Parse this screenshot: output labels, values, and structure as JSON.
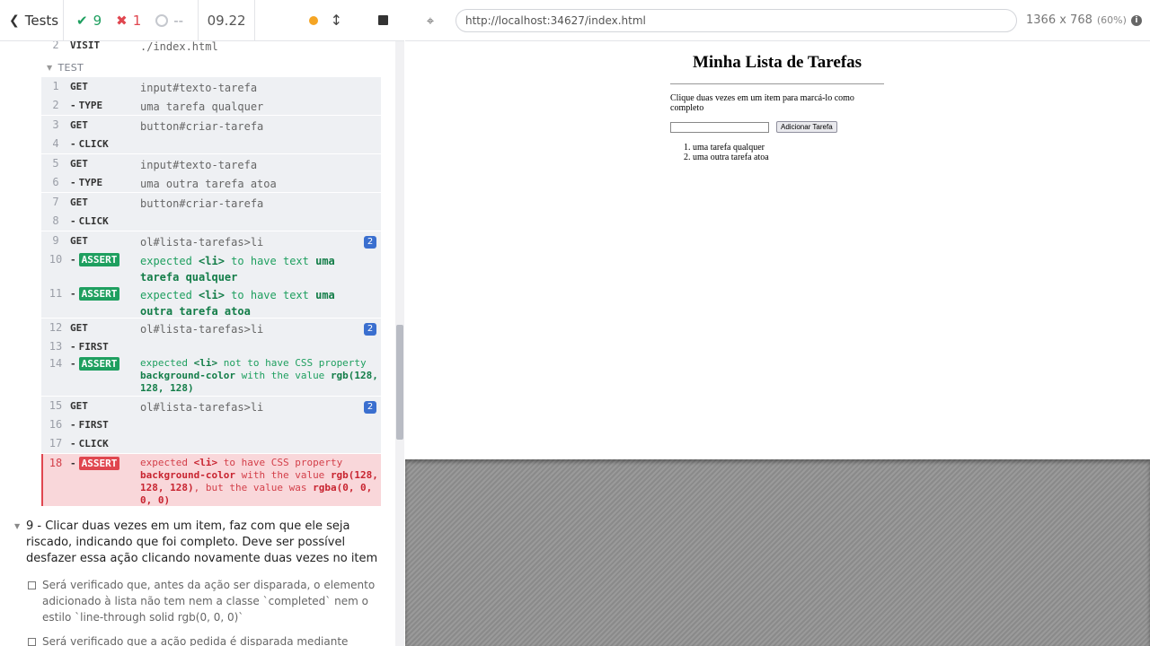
{
  "topbar": {
    "tests_label": "Tests",
    "passed": "9",
    "failed": "1",
    "pending": "--",
    "duration": "09.22"
  },
  "commands": {
    "visit": {
      "ln": "2",
      "name": "VISIT",
      "msg": "./index.html"
    },
    "test_label": "TEST",
    "rows": [
      {
        "ln": "1",
        "name": "GET",
        "msg": "input#texto-tarefa"
      },
      {
        "ln": "2",
        "name": "TYPE",
        "msg": "uma tarefa qualquer"
      },
      {
        "ln": "3",
        "name": "GET",
        "msg": "button#criar-tarefa"
      },
      {
        "ln": "4",
        "name": "CLICK",
        "msg": ""
      },
      {
        "ln": "5",
        "name": "GET",
        "msg": "input#texto-tarefa"
      },
      {
        "ln": "6",
        "name": "TYPE",
        "msg": "uma outra tarefa atoa"
      },
      {
        "ln": "7",
        "name": "GET",
        "msg": "button#criar-tarefa"
      },
      {
        "ln": "8",
        "name": "CLICK",
        "msg": ""
      },
      {
        "ln": "9",
        "name": "GET",
        "msg": "ol#lista-tarefas>li",
        "count": "2"
      },
      {
        "ln": "10",
        "name": "ASSERT",
        "pre": "expected",
        "el": "<li>",
        "mid": "to have text",
        "val1": "uma",
        "val2": "tarefa qualquer"
      },
      {
        "ln": "11",
        "name": "ASSERT",
        "pre": "expected",
        "el": "<li>",
        "mid": "to have text",
        "val1": "uma",
        "val2": "outra tarefa atoa"
      },
      {
        "ln": "12",
        "name": "GET",
        "msg": "ol#lista-tarefas>li",
        "count": "2"
      },
      {
        "ln": "13",
        "name": "FIRST",
        "msg": ""
      },
      {
        "ln": "14",
        "name": "ASSERT",
        "pre": "expected",
        "el": "<li>",
        "mid": "not to have CSS property",
        "prop": "background-color",
        "with": "with the value",
        "val": "rgb(128,",
        "val2": "128, 128)"
      },
      {
        "ln": "15",
        "name": "GET",
        "msg": "ol#lista-tarefas>li",
        "count": "2"
      },
      {
        "ln": "16",
        "name": "FIRST",
        "msg": ""
      },
      {
        "ln": "17",
        "name": "CLICK",
        "msg": ""
      },
      {
        "ln": "18",
        "name": "ASSERT",
        "pre": "expected",
        "el": "<li>",
        "mid": "to have CSS property",
        "prop": "background-color",
        "with": "with the value",
        "val": "rgb(128,",
        "val2": "128, 128)",
        "but": ", but the value was",
        "actual": "rgba(0, 0,",
        "actual2": "0, 0)"
      }
    ]
  },
  "requirement": {
    "title": "9 - Clicar duas vezes em um item, faz com que ele seja riscado, indicando que foi completo. Deve ser possível desfazer essa ação clicando novamente duas vezes no item",
    "checks": [
      "Será verificado que, antes da ação ser disparada, o elemento adicionado à lista não tem nem a classe `completed` nem o estilo `line-through solid rgb(0, 0, 0)`",
      "Será verificado que a ação pedida é disparada mediante"
    ]
  },
  "aut": {
    "url": "http://localhost:34627/index.html",
    "viewport": "1366 x 768",
    "scale": "(60%)",
    "app": {
      "title": "Minha Lista de Tarefas",
      "instructions": "Clique duas vezes em um item para marcá-lo como completo",
      "button": "Adicionar Tarefa",
      "items": [
        "uma tarefa qualquer",
        "uma outra tarefa atoa"
      ]
    }
  },
  "colors": {
    "pass": "#1e9f5f",
    "fail": "#e0464f",
    "running": "#f5a524"
  }
}
